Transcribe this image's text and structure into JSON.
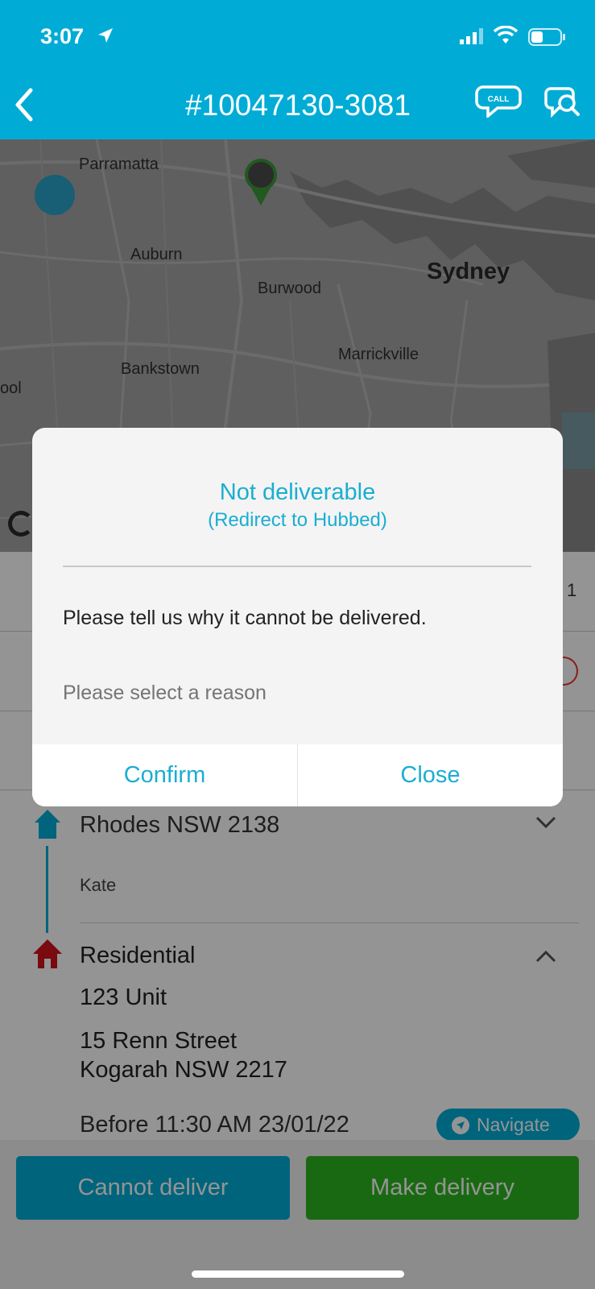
{
  "status_bar": {
    "time": "3:07"
  },
  "header": {
    "order_number": "#10047130-3081",
    "call_icon_text": "CALL"
  },
  "map": {
    "labels": {
      "parramatta": "Parramatta",
      "auburn": "Auburn",
      "burwood": "Burwood",
      "sydney": "Sydney",
      "marrickville": "Marrickville",
      "bankstown": "Bankstown",
      "edge": "ool"
    }
  },
  "list": {
    "row_number": "1",
    "pickup": {
      "address": "Rhodes NSW 2138",
      "contact": "Kate"
    },
    "dropoff": {
      "type": "Residential",
      "unit": "123 Unit",
      "street": "15 Renn Street",
      "suburb": "Kogarah NSW 2217",
      "deadline": "Before 11:30 AM 23/01/22",
      "navigate_label": "Navigate"
    }
  },
  "actions": {
    "cannot_deliver": "Cannot deliver",
    "make_delivery": "Make delivery"
  },
  "dialog": {
    "title": "Not deliverable",
    "subtitle": "(Redirect to Hubbed)",
    "message": "Please tell us why it cannot be delivered.",
    "reason_placeholder": "Please select a reason",
    "confirm_label": "Confirm",
    "close_label": "Close"
  },
  "colors": {
    "brand": "#00acd6",
    "success": "#2bb520",
    "home_red": "#d0121b"
  }
}
